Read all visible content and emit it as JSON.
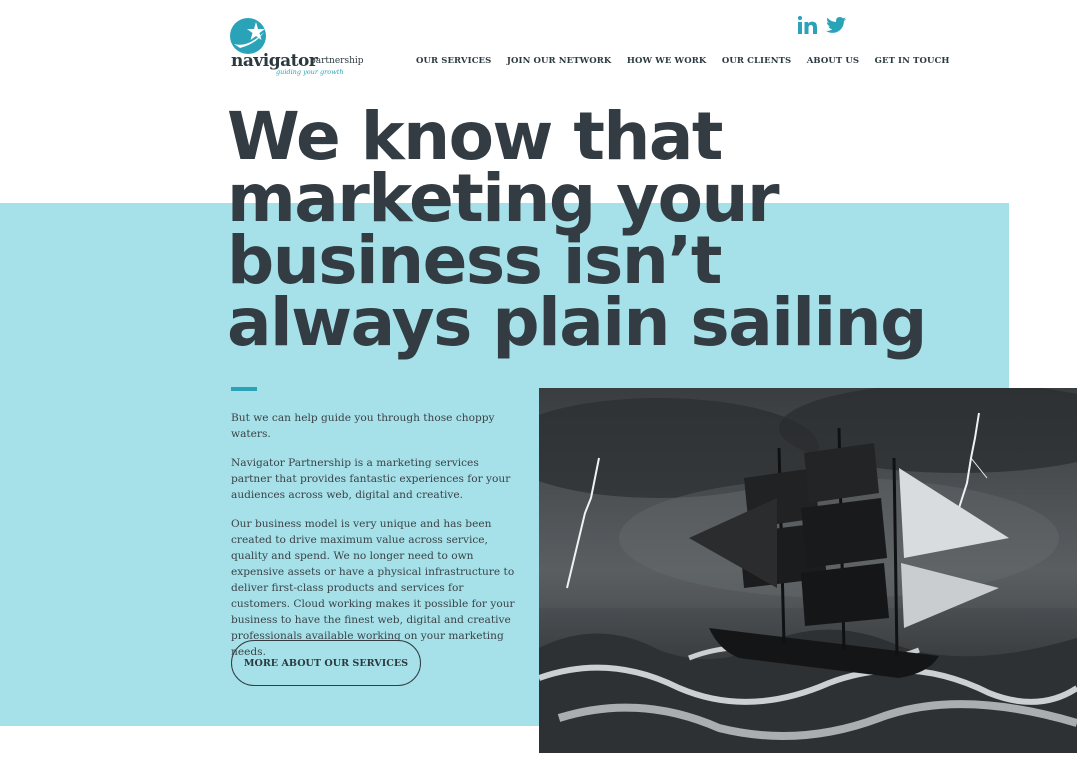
{
  "brand": {
    "name": "navigator",
    "suffix": "partnership",
    "tagline": "guiding your growth",
    "accent_color": "#2aa3b8",
    "band_color": "#a6e0e8",
    "text_color": "#333c43"
  },
  "social": [
    {
      "icon": "linkedin-icon"
    },
    {
      "icon": "twitter-icon"
    }
  ],
  "nav": {
    "items": [
      {
        "label": "OUR SERVICES"
      },
      {
        "label": "JOIN OUR NETWORK"
      },
      {
        "label": "HOW WE WORK"
      },
      {
        "label": "OUR CLIENTS"
      },
      {
        "label": "ABOUT US"
      },
      {
        "label": "GET IN TOUCH"
      }
    ]
  },
  "hero": {
    "lines": [
      "We know that",
      "marketing your",
      "business isn’t",
      "always plain sailing"
    ],
    "paragraphs": [
      "But we can help guide you through those choppy waters.",
      "Navigator Partnership is a marketing services partner that provides fantastic experiences for your audiences across web, digital and creative.",
      "Our business model is very unique and has been created to drive maximum value across service, quality and spend. We no longer need to own expensive assets or have a physical infrastructure to deliver first-class products and services for customers. Cloud working makes it possible for your business to have the finest web, digital and creative professionals available working on your marketing needs."
    ],
    "cta_label": "MORE ABOUT OUR SERVICES"
  }
}
